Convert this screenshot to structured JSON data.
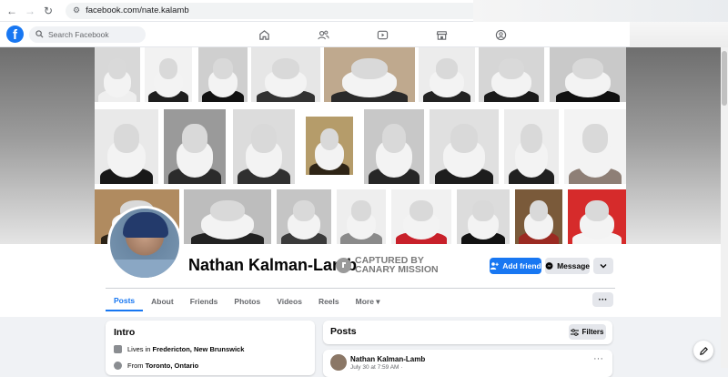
{
  "browser": {
    "url": "facebook.com/nate.kalamb",
    "nav_icons": [
      "back-arrow-icon",
      "forward-arrow-icon",
      "reload-icon"
    ]
  },
  "header": {
    "logo_letter": "f",
    "search_placeholder": "Search Facebook",
    "nav": [
      "home-icon",
      "friends-icon",
      "watch-icon",
      "marketplace-icon",
      "groups-icon"
    ]
  },
  "profile": {
    "name": "Nathan Kalman-Lamb",
    "badge_line1": "CAPTURED BY",
    "badge_line2": "CANARY MISSION",
    "add_friend": "Add friend",
    "message": "Message"
  },
  "tabs": {
    "items": [
      "Posts",
      "About",
      "Friends",
      "Photos",
      "Videos",
      "Reels",
      "More ▾"
    ],
    "active": "Posts"
  },
  "intro": {
    "title": "Intro",
    "lives_prefix": "Lives in ",
    "lives_city": "Fredericton, New Brunswick",
    "from_prefix": "From ",
    "from_city": "Toronto, Ontario"
  },
  "posts": {
    "title": "Posts",
    "filters": "Filters",
    "first_author": "Nathan Kalman-Lamb",
    "first_date": "July 30 at 7:59 AM ·"
  },
  "colors": {
    "accent": "#1877f2",
    "page_bg": "#f0f2f5"
  }
}
